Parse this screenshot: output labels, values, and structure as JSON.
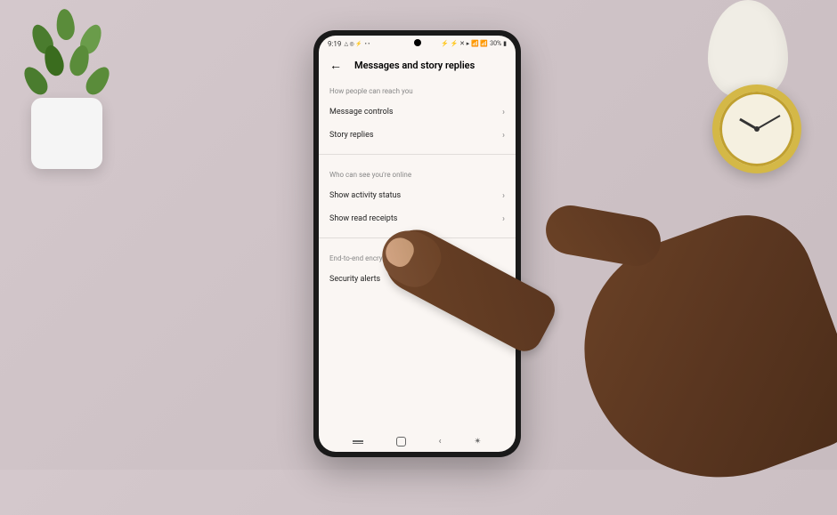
{
  "status": {
    "time": "9:19",
    "icons_left": "△ ◎ ⚡",
    "dots": "• •",
    "icons_right": "⚡ ⚡ ✕ ▸ 📶 📶",
    "battery": "30%",
    "battery_icon": "▮"
  },
  "header": {
    "title": "Messages and story replies"
  },
  "sections": [
    {
      "label": "How people can reach you",
      "items": [
        {
          "label": "Message controls"
        },
        {
          "label": "Story replies"
        }
      ]
    },
    {
      "label": "Who can see you're online",
      "items": [
        {
          "label": "Show activity status"
        },
        {
          "label": "Show read receipts"
        }
      ]
    },
    {
      "label": "End-to-end encryption",
      "items": [
        {
          "label": "Security alerts"
        }
      ]
    }
  ]
}
